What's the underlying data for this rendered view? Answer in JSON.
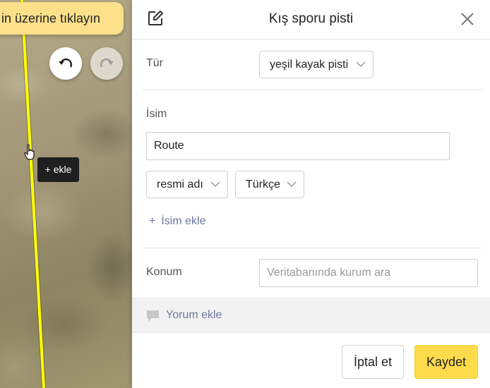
{
  "map": {
    "hint_text": "in üzerine tıklayın",
    "tooltip": "+ ekle",
    "undo_icon": "undo-icon",
    "redo_icon": "redo-icon",
    "route_color": "#ffff00"
  },
  "panel": {
    "title": "Kış sporu pisti",
    "edit_icon": "edit-icon",
    "close_icon": "close-icon",
    "type": {
      "label": "Tür",
      "value": "yeşil kayak pisti"
    },
    "name": {
      "label": "İsim",
      "value": "Route",
      "name_type": "resmi adı",
      "language": "Türkçe",
      "add_name": "İsim ekle"
    },
    "location": {
      "label": "Konum",
      "placeholder": "Veritabanında kurum ara"
    },
    "comment": "Yorum ekle",
    "buttons": {
      "cancel": "İptal et",
      "save": "Kaydet"
    }
  },
  "colors": {
    "accent": "#fddb4b",
    "link": "#6a78a0",
    "hint_bg": "#fce08a"
  }
}
